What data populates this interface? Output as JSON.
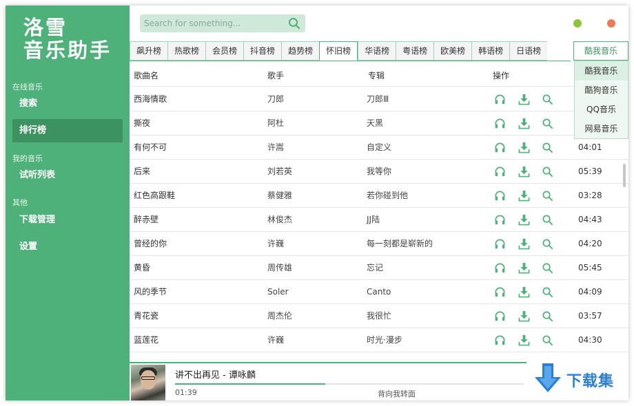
{
  "sidebar": {
    "logo_line1": "洛雪",
    "logo_line2": "音乐助手",
    "groups": {
      "online": "在线音乐",
      "mine": "我的音乐",
      "other": "其他"
    },
    "items": {
      "search": "搜索",
      "charts": "排行榜",
      "playlist": "试听列表",
      "downloads": "下载管理",
      "settings": "设置"
    }
  },
  "header": {
    "search_placeholder": "Search for something...",
    "colors": {
      "minimize": "#8cc63f",
      "close": "#ee7a55"
    }
  },
  "tabs": [
    {
      "label": "飙升榜"
    },
    {
      "label": "热歌榜"
    },
    {
      "label": "会员榜"
    },
    {
      "label": "抖音榜"
    },
    {
      "label": "趋势榜"
    },
    {
      "label": "怀旧榜"
    },
    {
      "label": "华语榜"
    },
    {
      "label": "粤语榜"
    },
    {
      "label": "欧美榜"
    },
    {
      "label": "韩语榜"
    },
    {
      "label": "日语榜"
    }
  ],
  "active_tab": "怀旧榜",
  "source": {
    "selected": "酷我音乐",
    "options": [
      "酷我音乐",
      "酷狗音乐",
      "QQ音乐",
      "网易音乐"
    ]
  },
  "table": {
    "headers": {
      "name": "歌曲名",
      "artist": "歌手",
      "album": "专辑",
      "actions": "操作"
    },
    "rows": [
      {
        "name": "西海情歌",
        "artist": "刀郎",
        "album": "刀郎Ⅲ",
        "duration": ""
      },
      {
        "name": "撕夜",
        "artist": "阿杜",
        "album": "天黑",
        "duration": ""
      },
      {
        "name": "有何不可",
        "artist": "许嵩",
        "album": "自定义",
        "duration": "04:01"
      },
      {
        "name": "后来",
        "artist": "刘若英",
        "album": "我等你",
        "duration": "05:39"
      },
      {
        "name": "红色高跟鞋",
        "artist": "蔡健雅",
        "album": "若你碰到他",
        "duration": "03:28"
      },
      {
        "name": "醉赤壁",
        "artist": "林俊杰",
        "album": "JJ陆",
        "duration": "04:43"
      },
      {
        "name": "曾经的你",
        "artist": "许巍",
        "album": "每一刻都是崭新的",
        "duration": "04:20"
      },
      {
        "name": "黄昏",
        "artist": "周传雄",
        "album": "忘记",
        "duration": "05:45"
      },
      {
        "name": "风的季节",
        "artist": "Soler",
        "album": "Canto",
        "duration": "04:09"
      },
      {
        "name": "青花瓷",
        "artist": "周杰伦",
        "album": "我很忙",
        "duration": "03:57"
      },
      {
        "name": "蓝莲花",
        "artist": "许巍",
        "album": "时光·漫步",
        "duration": "04:30"
      }
    ]
  },
  "player": {
    "title": "讲不出再见 - 谭咏麟",
    "elapsed": "01:39",
    "lyric": "背向我转面",
    "progress_fraction": 0.43
  },
  "watermark": {
    "text": "下载集"
  },
  "colors": {
    "accent": "#4fb17a",
    "accent_dark": "#3d9262",
    "watermark": "#2a7fd4"
  }
}
